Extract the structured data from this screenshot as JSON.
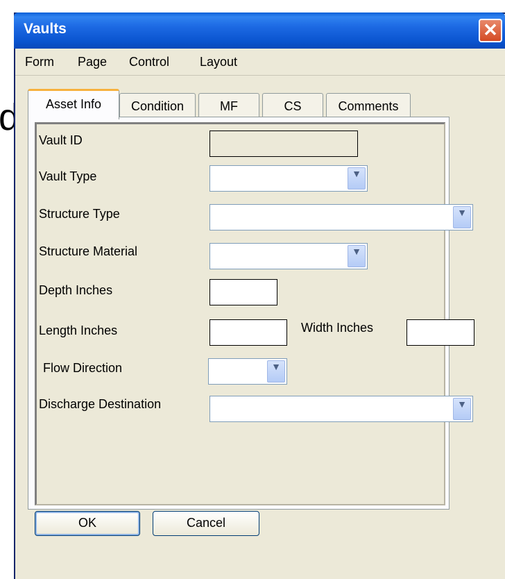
{
  "window": {
    "title": "Vaults",
    "close_symbol": "✕"
  },
  "background_fragment": "d",
  "menu": [
    "Form",
    "Page",
    "Control",
    "Layout"
  ],
  "tabs": [
    "Asset Info",
    "Condition",
    "MF",
    "CS",
    "Comments"
  ],
  "active_tab": "Asset Info",
  "fields": {
    "vault_id": {
      "label": "Vault ID",
      "value": ""
    },
    "vault_type": {
      "label": "Vault Type",
      "value": ""
    },
    "structure_type": {
      "label": "Structure Type",
      "value": ""
    },
    "structure_material": {
      "label": "Structure Material",
      "value": ""
    },
    "depth_inches": {
      "label": "Depth Inches",
      "value": ""
    },
    "length_inches": {
      "label": "Length Inches",
      "value": ""
    },
    "width_inches": {
      "label": "Width Inches",
      "value": ""
    },
    "flow_direction": {
      "label": "Flow Direction",
      "value": ""
    },
    "discharge_destination": {
      "label": "Discharge Destination",
      "value": ""
    }
  },
  "dropdown_arrow": "▼",
  "buttons": {
    "ok": "OK",
    "cancel": "Cancel"
  }
}
